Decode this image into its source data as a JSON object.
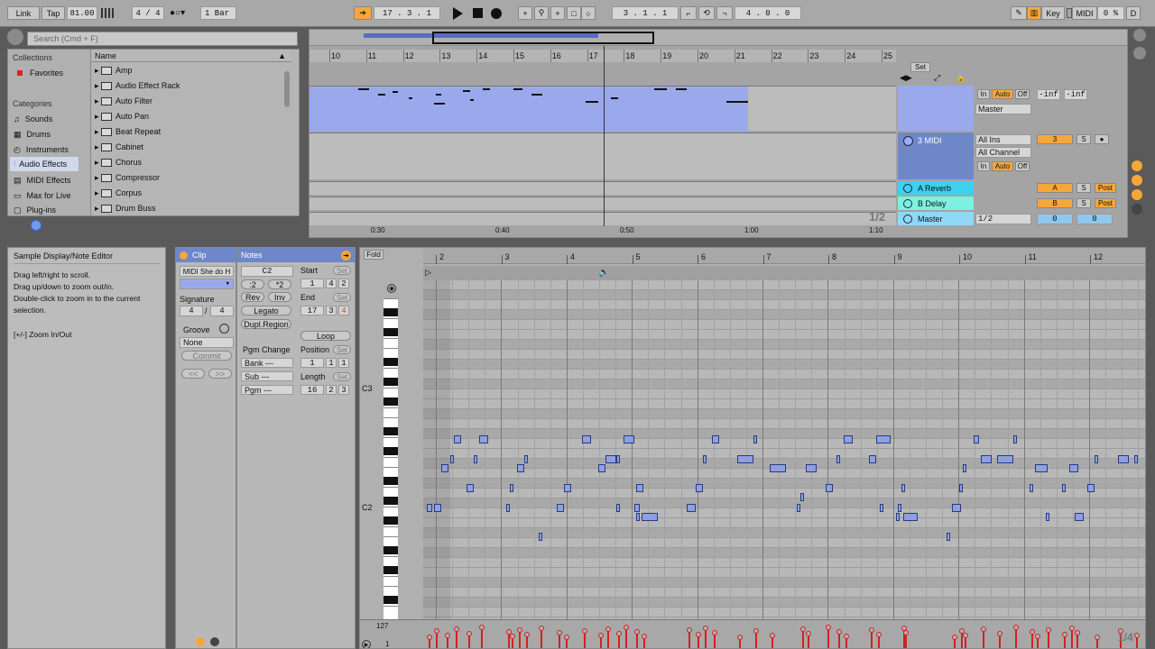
{
  "transport": {
    "link": "Link",
    "tap": "Tap",
    "tempo": "81.00",
    "signature": "4 / 4",
    "quant": "1 Bar",
    "position": "17 . 3 . 1",
    "loop_start": "3 . 1 . 1",
    "loop_length": "4 . 0 . 0",
    "key": "Key",
    "midi": "MIDI",
    "cpu": "0 %",
    "d": "D"
  },
  "browser": {
    "search_placeholder": "Search (Cmd + F)",
    "collections_header": "Collections",
    "favorites": "Favorites",
    "categories_header": "Categories",
    "categories": [
      "Sounds",
      "Drums",
      "Instruments",
      "Audio Effects",
      "MIDI Effects",
      "Max for Live",
      "Plug-ins"
    ],
    "name_header": "Name",
    "items": [
      "Amp",
      "Audio Effect Rack",
      "Auto Filter",
      "Auto Pan",
      "Beat Repeat",
      "Cabinet",
      "Chorus",
      "Compressor",
      "Corpus",
      "Drum Buss"
    ]
  },
  "arrangement": {
    "ruler": [
      "10",
      "11",
      "12",
      "13",
      "14",
      "15",
      "16",
      "17",
      "18",
      "19",
      "20",
      "21",
      "22",
      "23",
      "24",
      "25"
    ],
    "time": [
      "0:30",
      "0:40",
      "0:50",
      "1:00",
      "1:10"
    ],
    "set": "Set",
    "zoom_label": "1/2",
    "tracks": [
      {
        "name": "",
        "in": "In",
        "auto": "Auto",
        "off": "Off",
        "route": "Master",
        "vol1": "-inf",
        "vol2": "-inf"
      },
      {
        "name": "3 MIDI",
        "route_in": "All Ins",
        "channel": "All Channel",
        "in": "In",
        "auto": "Auto",
        "off": "Off",
        "num": "3",
        "s": "S"
      },
      {
        "name": "A Reverb",
        "letter": "A",
        "s": "S",
        "post": "Post"
      },
      {
        "name": "B Delay",
        "letter": "B",
        "s": "S",
        "post": "Post"
      },
      {
        "name": "Master",
        "route": "1/2",
        "v1": "0",
        "v2": "0"
      }
    ]
  },
  "info": {
    "title": "Sample Display/Note Editor",
    "lines": [
      "Drag left/right to scroll.",
      "Drag up/down to zoom out/in.",
      "Double-click to zoom in to the current",
      "selection."
    ],
    "zoom_hint": "[+/-] Zoom In/Out"
  },
  "clip": {
    "header": "Clip",
    "name": "MIDI She do H",
    "signature_label": "Signature",
    "sig_num": "4",
    "sig_den": "4",
    "groove_label": "Groove",
    "groove_value": "None",
    "commit": "Commit",
    "prev": "<<",
    "next": ">>"
  },
  "notes": {
    "header": "Notes",
    "transpose": "C2",
    "half": ":2",
    "double": "*2",
    "rev": "Rev",
    "inv": "Inv",
    "legato": "Legato",
    "dupl": "Dupl.Region",
    "pgm_change": "Pgm Change",
    "bank": "Bank ---",
    "sub": "Sub ---",
    "pgm": "Pgm ---",
    "start_label": "Start",
    "set": "Set",
    "start": [
      "1",
      "4",
      "2"
    ],
    "end_label": "End",
    "end": [
      "17",
      "3",
      "4"
    ],
    "loop": "Loop",
    "position_label": "Position",
    "position": [
      "1",
      "1",
      "1"
    ],
    "length_label": "Length",
    "length": [
      "16",
      "2",
      "3"
    ]
  },
  "roll": {
    "fold": "Fold",
    "bars": [
      "2",
      "3",
      "4",
      "5",
      "6",
      "7",
      "8",
      "9",
      "10",
      "11",
      "12"
    ],
    "c3": "C3",
    "c2": "C2",
    "vel_max": "127",
    "vel_min": "1",
    "grid": "1/4"
  }
}
